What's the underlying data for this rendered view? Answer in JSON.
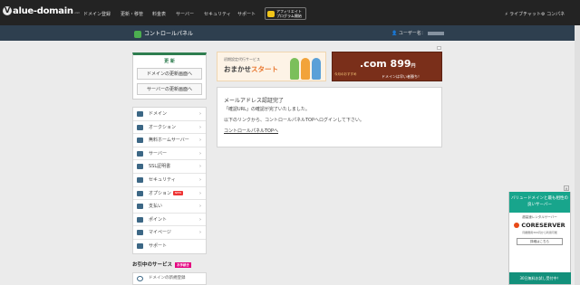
{
  "topbar": {
    "logo_text": "alue-domain",
    "logo_sub": ".com",
    "nav": [
      "ドメイン登録",
      "更新・移管",
      "料金表",
      "サーバー",
      "セキュリティ",
      "サポート"
    ],
    "affiliate": "アフィリエイトプログラム開始",
    "live_chat": "ライブチャット",
    "concierge": "コンパネ"
  },
  "subbar": {
    "title": "コントロールパネル",
    "user_label": "ユーザー名："
  },
  "sidebar": {
    "domain_box_title": "更 新",
    "domain_buttons": [
      "ドメインの更新画面へ",
      "サーバーの更新画面へ"
    ],
    "items": [
      {
        "label": "ドメイン"
      },
      {
        "label": "オークション"
      },
      {
        "label": "無料ホームサーバー"
      },
      {
        "label": "サーバー"
      },
      {
        "label": "SSL証明書"
      },
      {
        "label": "セキュリティ"
      },
      {
        "label": "オプション",
        "badge": "NEW"
      },
      {
        "label": "支払い"
      },
      {
        "label": "ポイント"
      },
      {
        "label": "マイページ"
      },
      {
        "label": "サポート"
      }
    ],
    "services_title": "お引中のサービス",
    "services_badge": "お手続き",
    "service_item": "ドメインの新規登録"
  },
  "banners": {
    "left_small": "初期設定代行サービス",
    "left_main_a": "おまかせ",
    "left_main_b": "スタート",
    "right_price": ".com 899",
    "right_unit": "円",
    "right_note": "今月のおすすめ",
    "right_sub": "ドメインは早い者勝ち！"
  },
  "message": {
    "title": "メールアドレス認証完了",
    "line1": "「確認URL」の確認が完了いたしました。",
    "line2": "以下のリンクから、コントロールパネルTOPへログインして下さい。",
    "link": "コントロールパネルTOPへ"
  },
  "ad": {
    "header": "バリュードメインと最も相性の良いサーバー",
    "sub": "超高速レンタルサーバー",
    "logo": "CORESERVER",
    "small": "月額費用300円から利用可能",
    "button": "詳細はこちら",
    "footer": "30日無料お試し受付中！"
  }
}
